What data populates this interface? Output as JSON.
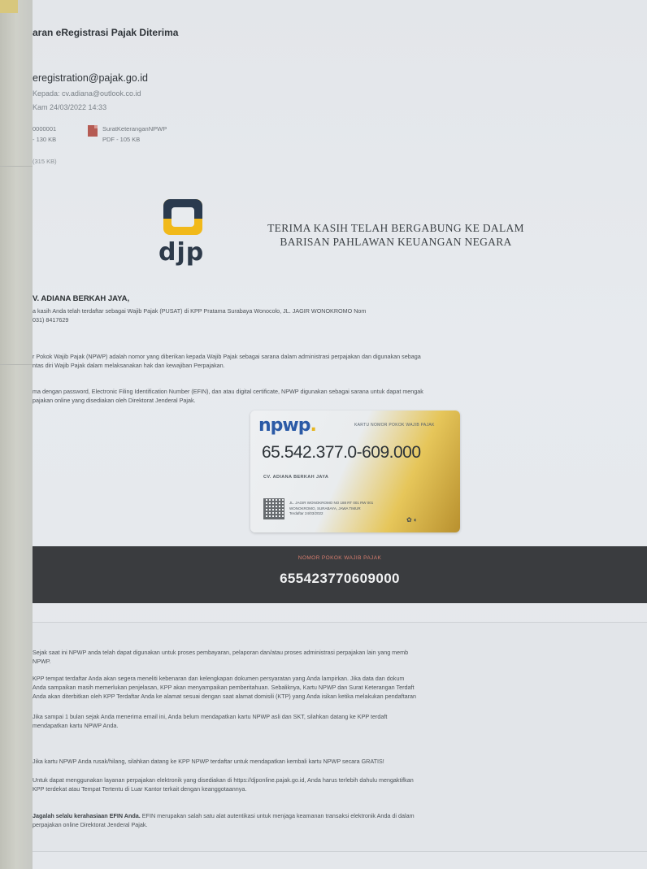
{
  "email": {
    "subject": "aran eRegistrasi Pajak Diterima",
    "sender": "eregistration@pajak.go.id",
    "to_line": "Kepada: cv.adiana@outlook.co.id",
    "date_line": "Kam 24/03/2022 14:33",
    "attachments": [
      {
        "name": "0000001",
        "size": "- 130 KB",
        "type": "pdf"
      },
      {
        "name": "SuratKeteranganNPWP",
        "size": "PDF - 105 KB",
        "type": "pdf"
      }
    ],
    "total_size": "(315 KB)"
  },
  "logo": {
    "text": "djp"
  },
  "welcome": {
    "line1": "TERIMA KASIH TELAH BERGABUNG KE DALAM",
    "line2": "BARISAN PAHLAWAN KEUANGAN NEGARA"
  },
  "body": {
    "addressee": "V. ADIANA BERKAH JAYA,",
    "intro_line1": "a kasih Anda telah terdaftar sebagai Wajib Pajak (PUSAT) di KPP Pratama Surabaya Wonocolo, JL. JAGIR WONOKROMO Nom",
    "intro_line2": "031) 8417629",
    "npwp_def_line1": "r Pokok Wajib Pajak (NPWP) adalah nomor yang diberikan kepada Wajib Pajak sebagai sarana dalam administrasi perpajakan dan digunakan sebaga",
    "npwp_def_line2": "ntas diri Wajib Pajak dalam melaksanakan hak dan kewajiban Perpajakan.",
    "efin_line1": "ma dengan password, Electronic Filing Identification Number (EFIN), dan atau digital certificate, NPWP digunakan sebagai sarana untuk dapat mengak",
    "efin_line2": "pajakan online yang disediakan oleh Direktorat Jenderal Pajak."
  },
  "card": {
    "brand": "npwp",
    "header": "KARTU NOMOR POKOK WAJIB PAJAK",
    "number": "65.542.377.0-609.000",
    "name": "CV. ADIANA BERKAH JAYA",
    "info": "JL. JAGIR WONOKROMO NO 188 RT 001 RW 001 WONOKROMO, SURABAYA, JAWA TIMUR",
    "registered": "Terdaftar 24/03/2022"
  },
  "banner": {
    "label": "NOMOR POKOK WAJIB PAJAK",
    "number": "655423770609000"
  },
  "info": {
    "p1_line1": "Sejak saat ini NPWP anda telah dapat digunakan untuk proses pembayaran, pelaporan dan/atau proses administrasi perpajakan lain yang memb",
    "p1_line2": "NPWP.",
    "p2_line1": "KPP tempat terdaftar Anda akan segera meneliti kebenaran dan kelengkapan dokumen persyaratan yang Anda lampirkan. Jika data dan dokum",
    "p2_line2": "Anda sampaikan masih memerlukan penjelasan, KPP akan menyampaikan pemberitahuan. Sebaliknya, Kartu NPWP dan Surat Keterangan Terdaft",
    "p2_line3": "Anda akan diterbitkan oleh KPP Terdaftar Anda ke alamat sesuai dengan saat alamat domisili (KTP) yang Anda isikan ketika melakukan pendaftaran",
    "p3_line1": "Jika sampai 1 bulan sejak Anda menerima email ini, Anda belum mendapatkan kartu NPWP asli dan SKT, silahkan datang ke KPP terdaft",
    "p3_line2": "mendapatkan kartu NPWP Anda.",
    "p4_line1": "Jika kartu NPWP Anda rusak/hilang, silahkan datang ke KPP NPWP terdaftar untuk mendapatkan kembali kartu NPWP secara GRATIS!",
    "p5_line1": "Untuk dapat menggunakan layanan perpajakan elektronik yang disediakan di https://djponline.pajak.go.id, Anda harus terlebih dahulu mengaktifkan",
    "p5_line2": "KPP terdekat atau Tempat Tertentu di Luar Kantor terkait dengan keanggotaannya.",
    "p6_bold": "Jagalah selalu kerahasiaan EFIN Anda.",
    "p6_line1_rest": " EFIN merupakan salah satu alat autentikasi untuk menjaga keamanan transaksi elektronik Anda di dalam",
    "p6_line2": "perpajakan online Direktorat Jenderal Pajak."
  },
  "colors": {
    "page_bg": "#e5e8ec",
    "banner_bg": "#3a3c3f",
    "banner_label": "#d77d6e",
    "card_gold": "#e6c65a",
    "npwp_blue": "#2b5aa6",
    "logo_navy": "#2a3a4e",
    "logo_gold": "#f1b91a"
  }
}
